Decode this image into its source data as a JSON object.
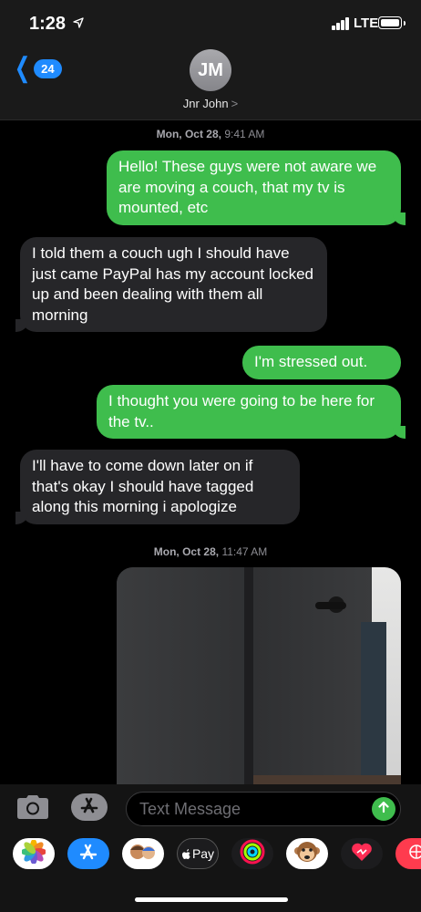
{
  "status_bar": {
    "time": "1:28",
    "network": "LTE"
  },
  "header": {
    "back_badge": "24",
    "avatar_initials": "JM",
    "contact_name": "Jnr John",
    "contact_chevron": ">"
  },
  "conversation": {
    "timestamp_1": {
      "day": "Mon, Oct 28,",
      "time": "9:41 AM"
    },
    "messages": [
      {
        "sender": "me",
        "text": "Hello! These guys were not aware we are moving a couch, that my tv is mounted, etc"
      },
      {
        "sender": "them",
        "text": "I told them a couch ugh I should have just came PayPal has my account locked up and been dealing with them all morning"
      },
      {
        "sender": "me",
        "text": "I'm stressed out."
      },
      {
        "sender": "me",
        "text": "I thought you were going to be here for the tv.."
      },
      {
        "sender": "them",
        "text": "I'll have to come down later on if that's okay I should have tagged along this morning i apologize"
      }
    ],
    "timestamp_2": {
      "day": "Mon, Oct 28,",
      "time": "11:47 AM"
    }
  },
  "input": {
    "placeholder": "Text Message"
  },
  "app_drawer": {
    "apps": [
      "photos-icon",
      "app-store-icon",
      "memoji-stickers-icon",
      "apple-pay-icon",
      "activity-icon",
      "animoji-icon",
      "digital-touch-icon",
      "search-icon"
    ],
    "apple_pay_label": "Pay"
  },
  "colors": {
    "sent_bubble": "#3fbd4d",
    "received_bubble": "#262629",
    "accent": "#1f8bff"
  }
}
